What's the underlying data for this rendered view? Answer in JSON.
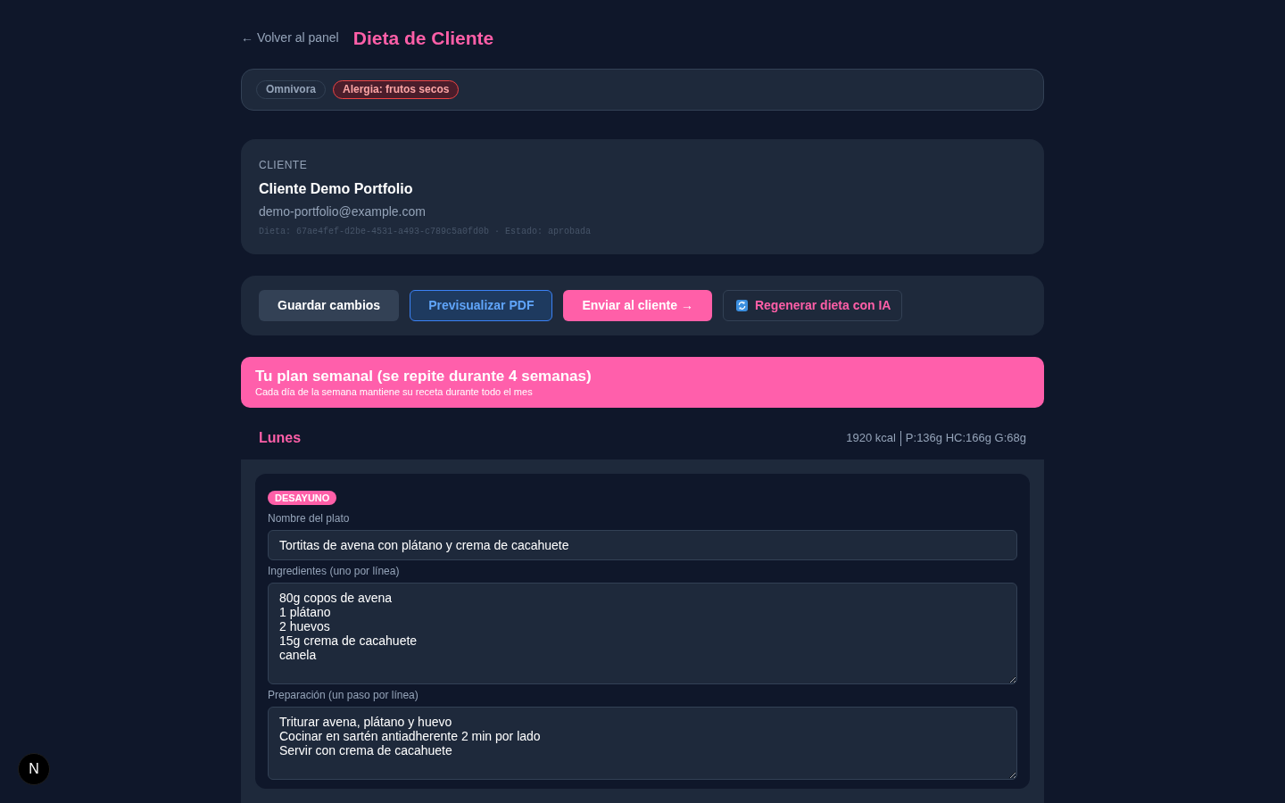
{
  "header": {
    "back_link": "← Volver al panel",
    "title": "Dieta de Cliente"
  },
  "tags": [
    {
      "label": "Omnivora",
      "kind": "diet"
    },
    {
      "label": "Alergia: frutos secos",
      "kind": "allergy"
    }
  ],
  "client": {
    "section_label": "CLIENTE",
    "name": "Cliente Demo Portfolio",
    "email": "demo-portfolio@example.com",
    "meta": "Dieta: 67ae4fef-d2be-4531-a493-c789c5a0fd0b · Estado: aprobada"
  },
  "actions": [
    {
      "label": "Guardar cambios",
      "kind": "secondary"
    },
    {
      "label": "Previsualizar PDF",
      "kind": "outline"
    },
    {
      "label": "Enviar al cliente →",
      "kind": "primary"
    },
    {
      "label": "Regenerar dieta con IA",
      "kind": "ai"
    }
  ],
  "plan_banner": {
    "title": "Tu plan semanal (se repite durante 4 semanas)",
    "subtitle": "Cada día de la semana mantiene su receta durante todo el mes"
  },
  "days": [
    {
      "name": "Lunes",
      "kcal": "1920 kcal",
      "macros": "P:136g HC:166g G:68g",
      "meals": [
        {
          "type": "DESAYUNO",
          "fields": [
            {
              "label": "Nombre del plato",
              "kind": "input",
              "lines": [
                "Tortitas de avena con plátano y crema de cacahuete"
              ]
            },
            {
              "label": "Ingredientes (uno por línea)",
              "kind": "textarea",
              "lines": [
                "80g copos de avena",
                "1 plátano",
                "2 huevos",
                "15g crema de cacahuete",
                "canela"
              ]
            },
            {
              "label": "Preparación (un paso por línea)",
              "kind": "textarea",
              "lines": [
                "Triturar avena, plátano y huevo",
                "Cocinar en sartén antiadherente 2 min por lado",
                "Servir con crema de cacahuete"
              ]
            }
          ]
        }
      ]
    }
  ],
  "dev_badge": {
    "label": "N"
  }
}
